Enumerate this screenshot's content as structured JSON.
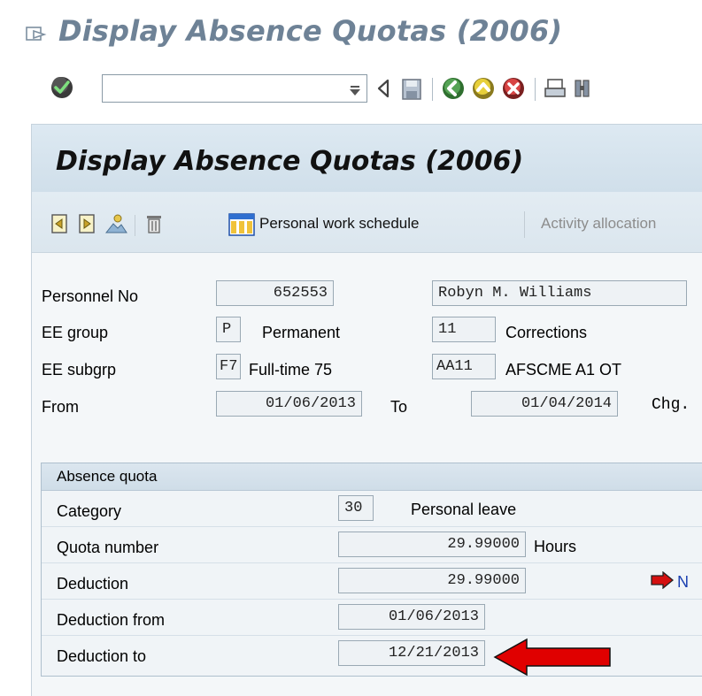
{
  "window": {
    "title": "Display Absence Quotas (2006)"
  },
  "toolbar": {
    "command_placeholder": "",
    "icons": [
      "enter-check-icon",
      "back-arrow-icon",
      "save-icon",
      "back-green-icon",
      "exit-yellow-icon",
      "cancel-red-icon",
      "print-icon",
      "find-icon"
    ]
  },
  "app": {
    "title": "Display Absence Quotas (2006)",
    "toolbar": {
      "personal_work_schedule": "Personal work schedule",
      "activity_allocation": "Activity allocation"
    }
  },
  "header": {
    "personnel_no_label": "Personnel No",
    "personnel_no": "652553",
    "name": "Robyn M. Williams",
    "ee_group_label": "EE group",
    "ee_group_code": "P",
    "ee_group_text": "Permanent",
    "area_code": "11",
    "area_text": "Corrections",
    "ee_subgrp_label": "EE subgrp",
    "ee_subgrp_code": "F7",
    "ee_subgrp_text": "Full-time 75",
    "payroll_area_code": "AA11",
    "payroll_area_text": "AFSCME A1 OT",
    "from_label": "From",
    "from_date": "01/06/2013",
    "to_label": "To",
    "to_date": "01/04/2014",
    "chg_label": "Chg."
  },
  "quota": {
    "group_title": "Absence quota",
    "category_label": "Category",
    "category_code": "30",
    "category_text": "Personal leave",
    "quota_number_label": "Quota number",
    "quota_number": "29.99000",
    "quota_unit": "Hours",
    "deduction_label": "Deduction",
    "deduction": "29.99000",
    "deduction_link": "N",
    "deduction_from_label": "Deduction from",
    "deduction_from": "01/06/2013",
    "deduction_to_label": "Deduction to",
    "deduction_to": "12/21/2013"
  },
  "colors": {
    "title_blue": "#6e8296",
    "annotation_arrow": "#e00000"
  }
}
